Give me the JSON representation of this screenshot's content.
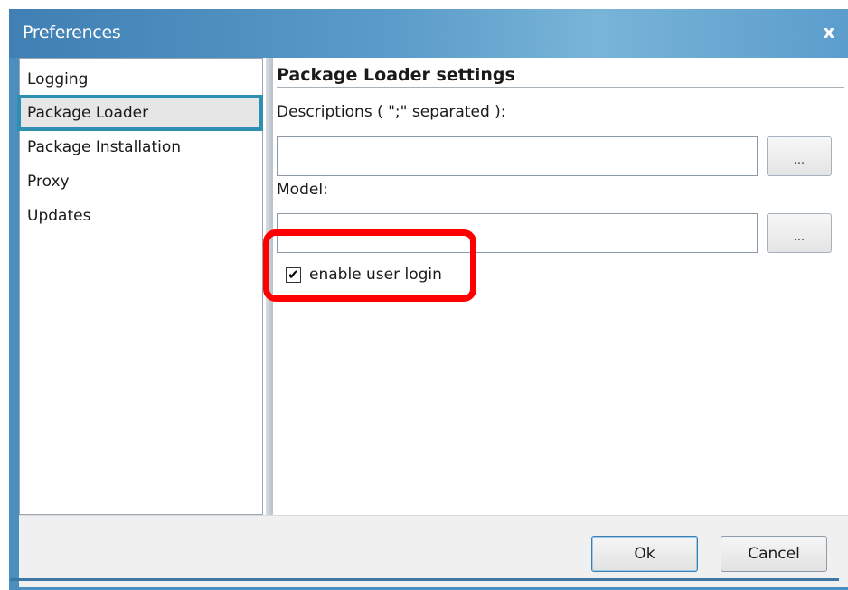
{
  "window": {
    "title": "Preferences",
    "close_label": "x"
  },
  "sidebar": {
    "items": [
      {
        "label": "Logging"
      },
      {
        "label": "Package Loader",
        "selected": true
      },
      {
        "label": "Package Installation"
      },
      {
        "label": "Proxy"
      },
      {
        "label": "Updates"
      }
    ]
  },
  "panel": {
    "title": "Package Loader settings",
    "descriptions_label": "Descriptions ( \";\" separated ):",
    "descriptions_value": "",
    "model_label": "Model:",
    "model_value": "",
    "browse_label": "...",
    "checkbox_label": "enable user login",
    "checkbox_checked": true,
    "checkbox_mark": "✔"
  },
  "footer": {
    "ok_label": "Ok",
    "cancel_label": "Cancel"
  },
  "colors": {
    "title_bar": "#5a9bc9",
    "selection_outline": "#2f8fb1",
    "highlight": "#ff0000"
  }
}
